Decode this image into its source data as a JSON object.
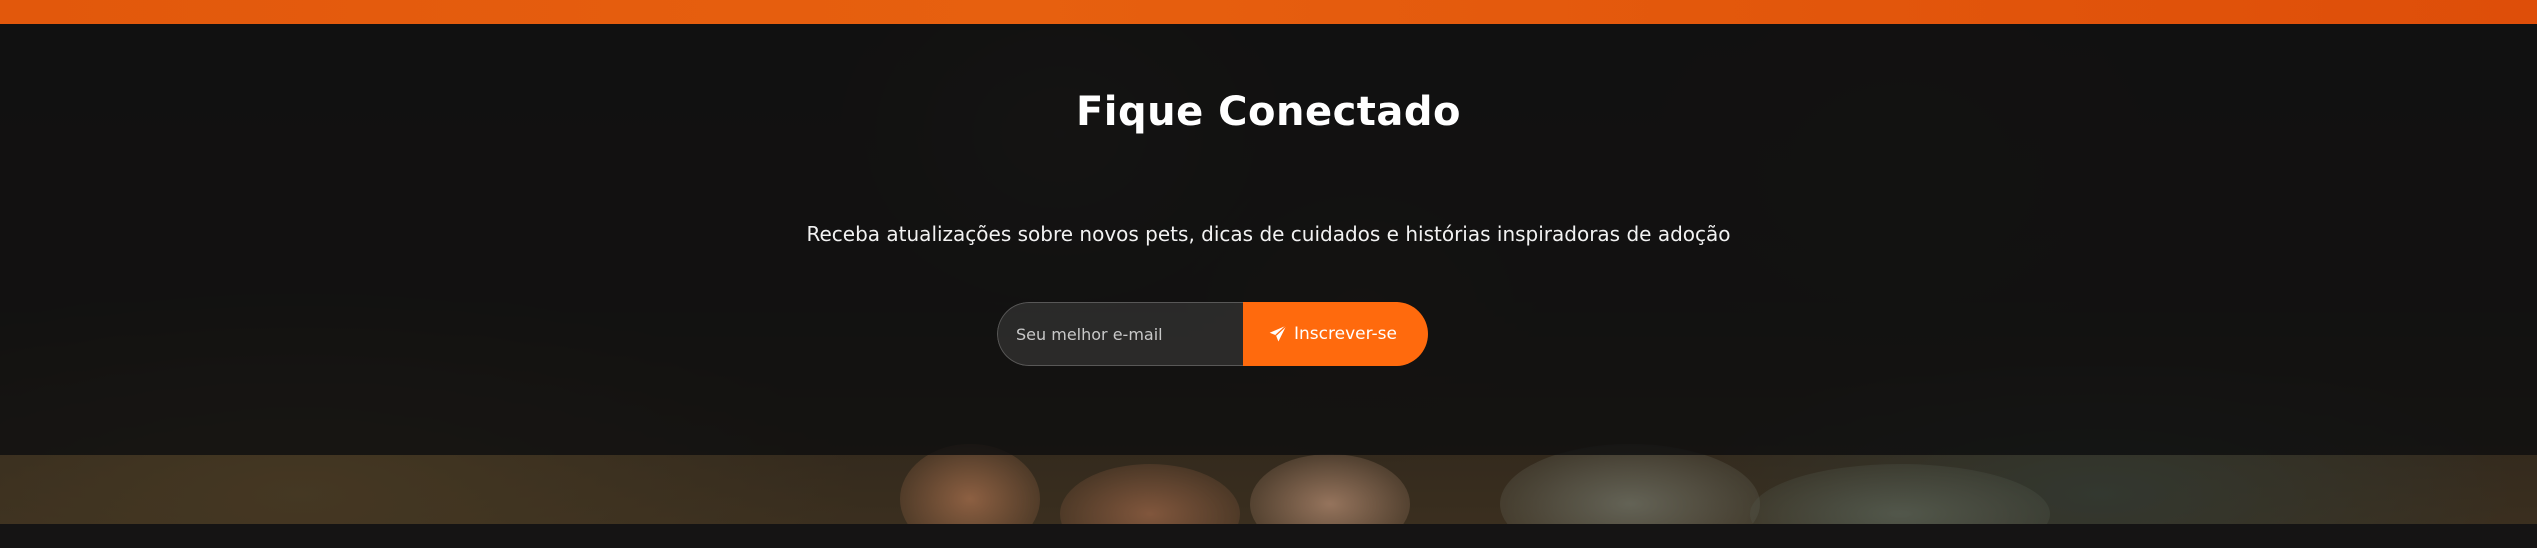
{
  "newsletter": {
    "title": "Fique Conectado",
    "subtitle": "Receba atualizações sobre novos pets, dicas de cuidados e histórias inspiradoras de adoção",
    "email_placeholder": "Seu melhor e-mail",
    "email_value": "",
    "submit_label": "Inscrever-se",
    "submit_icon": "paper-plane-icon"
  },
  "colors": {
    "accent": "#ff6a0d",
    "top_bar": "#e2580c",
    "overlay": "#0f0f0f"
  }
}
